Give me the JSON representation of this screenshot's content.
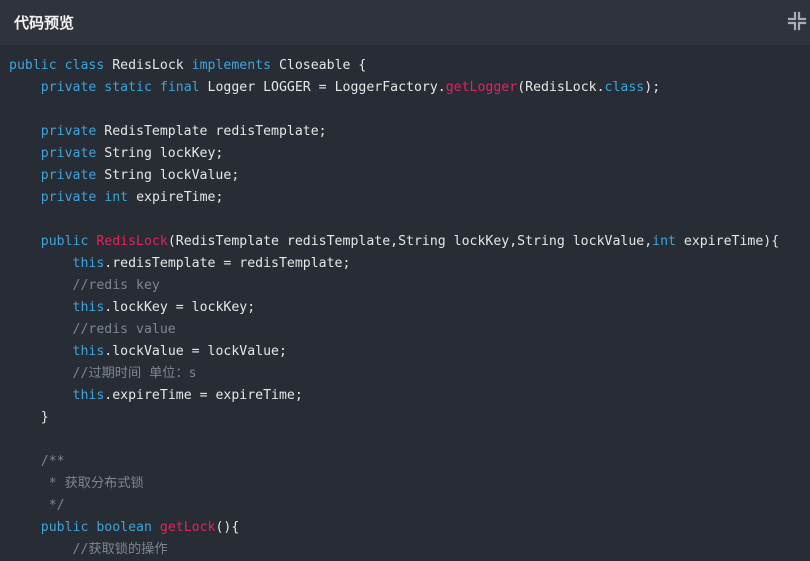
{
  "header": {
    "title": "代码预览",
    "collapse_icon": "collapse-icon"
  },
  "code": {
    "language": "java",
    "lines": [
      [
        [
          "kw",
          "public"
        ],
        [
          "pl",
          " "
        ],
        [
          "kw",
          "class"
        ],
        [
          "pl",
          " RedisLock "
        ],
        [
          "kw",
          "implements"
        ],
        [
          "pl",
          " Closeable {"
        ]
      ],
      [
        [
          "pl",
          "    "
        ],
        [
          "kw",
          "private"
        ],
        [
          "pl",
          " "
        ],
        [
          "kw",
          "static"
        ],
        [
          "pl",
          " "
        ],
        [
          "kw",
          "final"
        ],
        [
          "pl",
          " Logger LOGGER = LoggerFactory."
        ],
        [
          "fn",
          "getLogger"
        ],
        [
          "pl",
          "(RedisLock."
        ],
        [
          "kw",
          "class"
        ],
        [
          "pl",
          ");"
        ]
      ],
      [],
      [
        [
          "pl",
          "    "
        ],
        [
          "kw",
          "private"
        ],
        [
          "pl",
          " RedisTemplate redisTemplate;"
        ]
      ],
      [
        [
          "pl",
          "    "
        ],
        [
          "kw",
          "private"
        ],
        [
          "pl",
          " String lockKey;"
        ]
      ],
      [
        [
          "pl",
          "    "
        ],
        [
          "kw",
          "private"
        ],
        [
          "pl",
          " String lockValue;"
        ]
      ],
      [
        [
          "pl",
          "    "
        ],
        [
          "kw",
          "private"
        ],
        [
          "pl",
          " "
        ],
        [
          "kw",
          "int"
        ],
        [
          "pl",
          " expireTime;"
        ]
      ],
      [],
      [
        [
          "pl",
          "    "
        ],
        [
          "kw",
          "public"
        ],
        [
          "pl",
          " "
        ],
        [
          "fn",
          "RedisLock"
        ],
        [
          "pl",
          "(RedisTemplate redisTemplate,String lockKey,String lockValue,"
        ],
        [
          "kw",
          "int"
        ],
        [
          "pl",
          " expireTime){"
        ]
      ],
      [
        [
          "pl",
          "        "
        ],
        [
          "kw",
          "this"
        ],
        [
          "pl",
          ".redisTemplate = redisTemplate;"
        ]
      ],
      [
        [
          "pl",
          "        "
        ],
        [
          "cm",
          "//redis key"
        ]
      ],
      [
        [
          "pl",
          "        "
        ],
        [
          "kw",
          "this"
        ],
        [
          "pl",
          ".lockKey = lockKey;"
        ]
      ],
      [
        [
          "pl",
          "        "
        ],
        [
          "cm",
          "//redis value"
        ]
      ],
      [
        [
          "pl",
          "        "
        ],
        [
          "kw",
          "this"
        ],
        [
          "pl",
          ".lockValue = lockValue;"
        ]
      ],
      [
        [
          "pl",
          "        "
        ],
        [
          "cm",
          "//过期时间 单位：s"
        ]
      ],
      [
        [
          "pl",
          "        "
        ],
        [
          "kw",
          "this"
        ],
        [
          "pl",
          ".expireTime = expireTime;"
        ]
      ],
      [
        [
          "pl",
          "    }"
        ]
      ],
      [],
      [
        [
          "pl",
          "    "
        ],
        [
          "cm",
          "/**"
        ]
      ],
      [
        [
          "pl",
          "     "
        ],
        [
          "cm",
          "* 获取分布式锁"
        ]
      ],
      [
        [
          "pl",
          "     "
        ],
        [
          "cm",
          "*/"
        ]
      ],
      [
        [
          "pl",
          "    "
        ],
        [
          "kw",
          "public"
        ],
        [
          "pl",
          " "
        ],
        [
          "kw",
          "boolean"
        ],
        [
          "pl",
          " "
        ],
        [
          "fn",
          "getLock"
        ],
        [
          "pl",
          "(){"
        ]
      ],
      [
        [
          "pl",
          "        "
        ],
        [
          "cm",
          "//获取锁的操作"
        ]
      ]
    ]
  }
}
